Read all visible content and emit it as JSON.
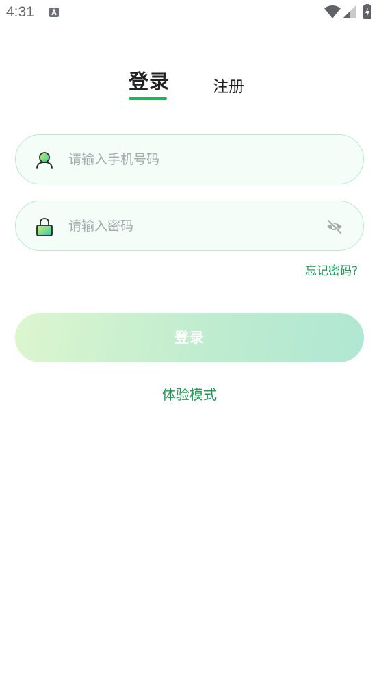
{
  "status_bar": {
    "time": "4:31"
  },
  "tabs": {
    "login_label": "登录",
    "register_label": "注册",
    "active": "login"
  },
  "form": {
    "phone_placeholder": "请输入手机号码",
    "phone_value": "",
    "password_placeholder": "请输入密码",
    "password_value": "",
    "forgot_label": "忘记密码?"
  },
  "actions": {
    "login_label": "登录",
    "trial_label": "体验模式"
  },
  "colors": {
    "accent": "#22b35e",
    "link": "#1a9c55",
    "field_border": "#b6ebd2",
    "field_bg": "#f5fdf9"
  },
  "icons": {
    "phone_field": "user-icon",
    "password_field": "lock-icon",
    "visibility": "eye-off-icon"
  }
}
